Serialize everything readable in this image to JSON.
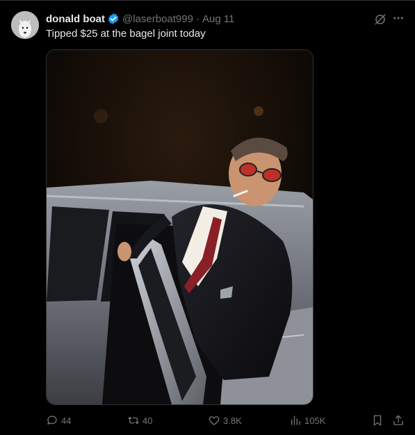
{
  "tweet": {
    "author_name": "donald boat",
    "handle": "@laserboat999",
    "separator": "·",
    "date": "Aug 11",
    "text": "Tipped $25 at the bagel joint today"
  },
  "metrics": {
    "replies": "44",
    "reposts": "40",
    "likes": "3.8K",
    "views": "105K"
  },
  "colors": {
    "background": "#000000",
    "text": "#e7e9ea",
    "secondary": "#71767b",
    "verified": "#1d9bf0",
    "border": "#2f3336"
  },
  "icons": {
    "verified": "verified-badge-icon",
    "grok": "grok-icon",
    "more": "more-icon",
    "reply": "reply-icon",
    "repost": "repost-icon",
    "like": "like-icon",
    "views": "views-icon",
    "bookmark": "bookmark-icon",
    "share": "share-icon"
  }
}
